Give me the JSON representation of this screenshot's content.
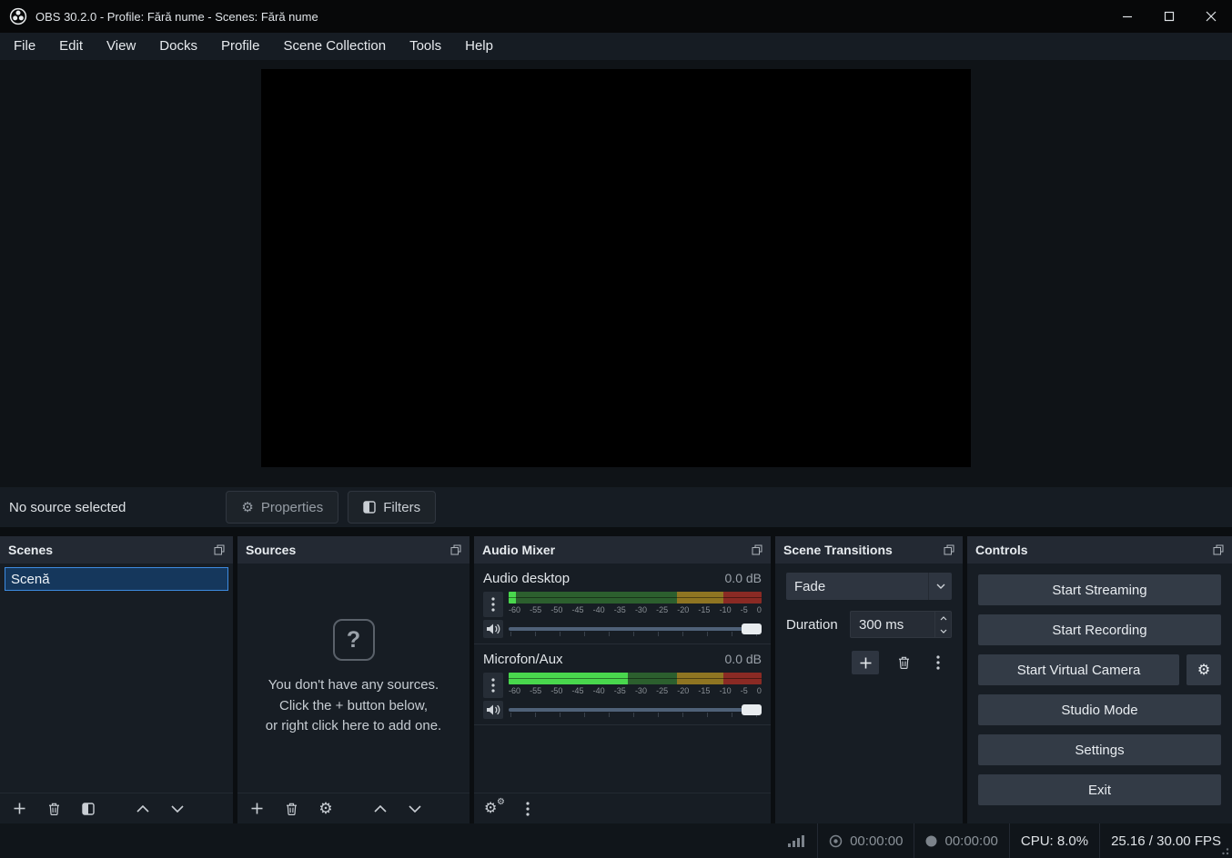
{
  "window": {
    "title": "OBS 30.2.0 - Profile: Fără nume - Scenes: Fără nume"
  },
  "menu": {
    "items": [
      "File",
      "Edit",
      "View",
      "Docks",
      "Profile",
      "Scene Collection",
      "Tools",
      "Help"
    ]
  },
  "source_row": {
    "status": "No source selected",
    "properties": "Properties",
    "filters": "Filters"
  },
  "scenes": {
    "title": "Scenes",
    "items": [
      {
        "name": "Scenă",
        "selected": true
      }
    ]
  },
  "sources": {
    "title": "Sources",
    "empty_icon": "?",
    "empty_lines": [
      "You don't have any sources.",
      "Click the + button below,",
      "or right click here to add one."
    ]
  },
  "mixer": {
    "title": "Audio Mixer",
    "scale": [
      "-60",
      "-55",
      "-50",
      "-45",
      "-40",
      "-35",
      "-30",
      "-25",
      "-20",
      "-15",
      "-10",
      "-5",
      "0"
    ],
    "channels": [
      {
        "name": "Audio desktop",
        "db": "0.0 dB",
        "level_style": "width:3%"
      },
      {
        "name": "Microfon/Aux",
        "db": "0.0 dB",
        "level_style": "width:47%"
      }
    ]
  },
  "transitions": {
    "title": "Scene Transitions",
    "current": "Fade",
    "duration_label": "Duration",
    "duration": "300 ms"
  },
  "controls": {
    "title": "Controls",
    "start_streaming": "Start Streaming",
    "start_recording": "Start Recording",
    "start_virtual_camera": "Start Virtual Camera",
    "studio_mode": "Studio Mode",
    "settings": "Settings",
    "exit": "Exit"
  },
  "status": {
    "rec_time": "00:00:00",
    "stream_time": "00:00:00",
    "cpu": "CPU: 8.0%",
    "fps": "25.16 / 30.00 FPS"
  },
  "icons": {
    "gear": "⚙"
  },
  "colors": {
    "accent_blue": "#3d8be0",
    "meter_green_active": "#49d74d",
    "meter_green_dim": "#2c5f2e",
    "meter_yellow_dim": "#8f7522",
    "meter_red_dim": "#8a2a24",
    "selected_scene_bg": "#15375c"
  }
}
